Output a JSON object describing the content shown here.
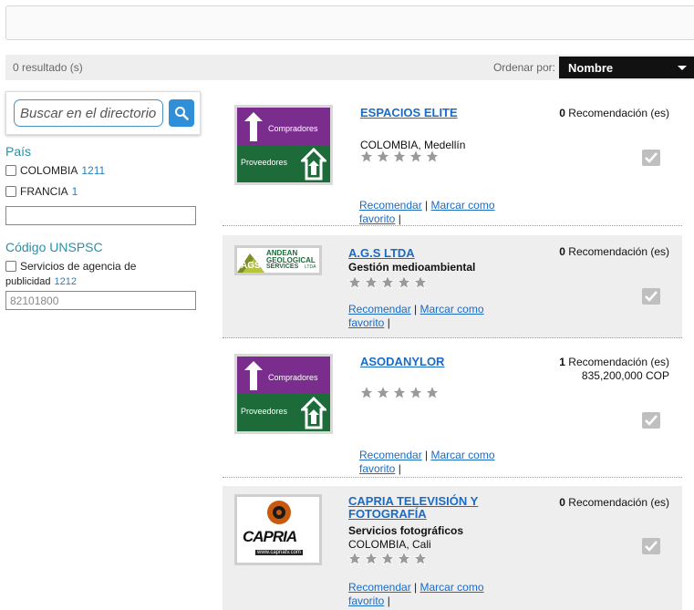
{
  "results": {
    "count_text": "0 resultado (s)",
    "sort_label": "Ordenar por:",
    "sort_value": "Nombre"
  },
  "search": {
    "placeholder": "Buscar en el directorio"
  },
  "facets": {
    "country": {
      "title": "País",
      "options": [
        {
          "label": "COLOMBIA",
          "count": "1211"
        },
        {
          "label": "FRANCIA",
          "count": "1"
        }
      ],
      "input_value": ""
    },
    "unspsc": {
      "title": "Código UNSPSC",
      "option_label_line1": "Servicios de agencia de",
      "option_label_line2": "publicidad",
      "option_count": "1212",
      "input_placeholder": "82101800"
    }
  },
  "listings": [
    {
      "name": "ESPACIOS ELITE",
      "subtitle": "",
      "location": "COLOMBIA, Medellín",
      "rec_count": "0",
      "rec_label": "Recomendación (es)",
      "amount": "",
      "logo": "compradores-proveedores",
      "recommend_label": "Recomendar",
      "favorite_label_1": "Marcar como",
      "favorite_label_2": "favorito"
    },
    {
      "name": "A.G.S LTDA",
      "subtitle": "Gestión medioambiental",
      "location": "",
      "rec_count": "0",
      "rec_label": "Recomendación (es)",
      "amount": "",
      "logo": "andean-geological",
      "recommend_label": "Recomendar",
      "favorite_label_1": "Marcar como",
      "favorite_label_2": "favorito"
    },
    {
      "name": "ASODANYLOR",
      "subtitle": "",
      "location": "",
      "rec_count": "1",
      "rec_label": "Recomendación (es)",
      "amount": "835,200,000 COP",
      "logo": "compradores-proveedores",
      "recommend_label": "Recomendar",
      "favorite_label_1": "Marcar como",
      "favorite_label_2": "favorito"
    },
    {
      "name_line1": "CAPRIA TELEVISIÓN Y",
      "name_line2": "FOTOGRAFÍA",
      "subtitle": "Servicios fotográficos",
      "location": "COLOMBIA, Cali",
      "rec_count": "0",
      "rec_label": "Recomendación (es)",
      "amount": "",
      "logo": "capria",
      "recommend_label": "Recomendar",
      "favorite_label_1": "Marcar como",
      "favorite_label_2": "favorito"
    }
  ],
  "logos": {
    "compradores": "Compradores",
    "proveedores": "Proveedores",
    "ags_top": "ANDEAN",
    "ags_mid": "GEOLOGICAL",
    "ags_bot": "SERVICES",
    "ags_ltda": "LTDA",
    "ags_mark": "AGS",
    "capria_word": "CAPRIA",
    "capria_url": "www.capriatv.com"
  },
  "colors": {
    "accent": "#2a8fa8",
    "link": "#1a6bc6",
    "purple": "#7b2d8e",
    "green": "#1e6b3a"
  }
}
